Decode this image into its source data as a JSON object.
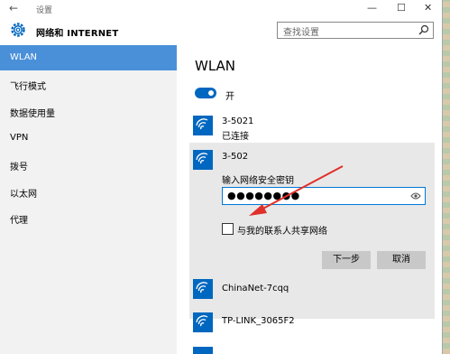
{
  "window": {
    "title": "设置",
    "back_icon": "back-arrow-icon"
  },
  "header": {
    "app_title": "网络和 INTERNET",
    "search_placeholder": "查找设置"
  },
  "sidebar": {
    "items": [
      {
        "label": "WLAN",
        "active": true
      },
      {
        "label": "飞行模式"
      },
      {
        "label": "数据使用量"
      },
      {
        "label": "VPN"
      },
      {
        "label": "拨号"
      },
      {
        "label": "以太网"
      },
      {
        "label": "代理"
      }
    ]
  },
  "main": {
    "title": "WLAN",
    "toggle_label": "开",
    "networks": [
      {
        "name": "3-5021",
        "status": "已连接"
      },
      {
        "name": "3-502"
      },
      {
        "name": "ChinaNet-7cqq"
      },
      {
        "name": "TP-LINK_3065F2"
      }
    ],
    "selected": {
      "key_label": "输入网络安全密钥",
      "password": "●●●●●●●●",
      "share_label": "与我的联系人共享网络",
      "next_button": "下一步",
      "cancel_button": "取消"
    }
  },
  "colors": {
    "accent": "#0067c0",
    "nav_active": "#4a90d9",
    "annotation_arrow": "#e0302b"
  }
}
